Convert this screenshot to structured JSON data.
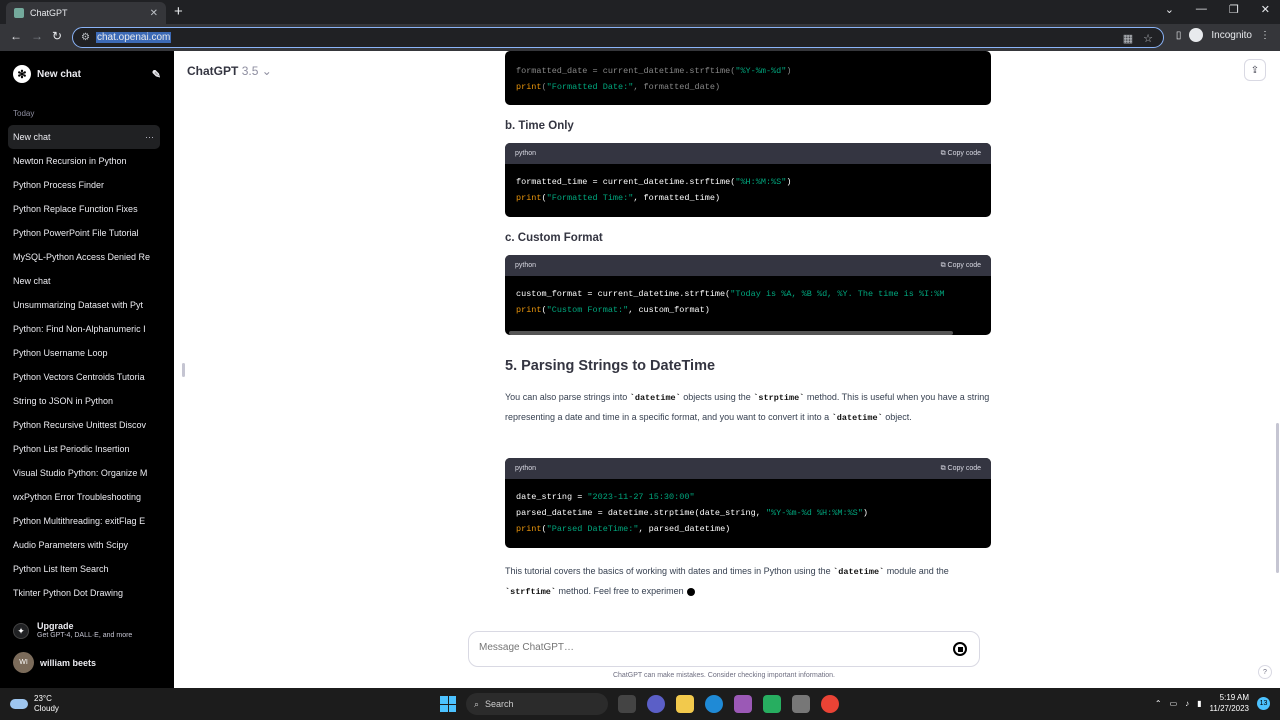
{
  "browser": {
    "tab_title": "ChatGPT",
    "url": "chat.openai.com",
    "profile": "Incognito"
  },
  "sidebar": {
    "new_chat": "New chat",
    "section": "Today",
    "items": [
      "New chat",
      "Newton Recursion in Python",
      "Python Process Finder",
      "Python Replace Function Fixes",
      "Python PowerPoint File Tutorial",
      "MySQL-Python Access Denied Re",
      "New chat",
      "Unsummarizing Dataset with Pyt",
      "Python: Find Non-Alphanumeric I",
      "Python Username Loop",
      "Python Vectors Centroids Tutoria",
      "String to JSON in Python",
      "Python Recursive Unittest Discov",
      "Python List Periodic Insertion",
      "Visual Studio Python: Organize M",
      "wxPython Error Troubleshooting",
      "Python Multithreading: exitFlag E",
      "Audio Parameters with Scipy",
      "Python List Item Search",
      "Tkinter Python Dot Drawing"
    ],
    "upgrade_title": "Upgrade",
    "upgrade_sub": "Get GPT-4, DALL·E, and more",
    "user_initials": "WI",
    "user_name": "william beets"
  },
  "main": {
    "model": "ChatGPT",
    "model_version": "3.5",
    "heading_b": "b. Time Only",
    "heading_c": "c. Custom Format",
    "heading_5": "5. Parsing Strings to DateTime",
    "code_lang": "python",
    "copy_label": "Copy code",
    "composer_placeholder": "Message ChatGPT…",
    "disclaimer": "ChatGPT can make mistakes. Consider checking important information."
  },
  "taskbar": {
    "temp": "23°C",
    "weather": "Cloudy",
    "search": "Search",
    "time": "5:19 AM",
    "date": "11/27/2023",
    "notif_count": "13"
  }
}
